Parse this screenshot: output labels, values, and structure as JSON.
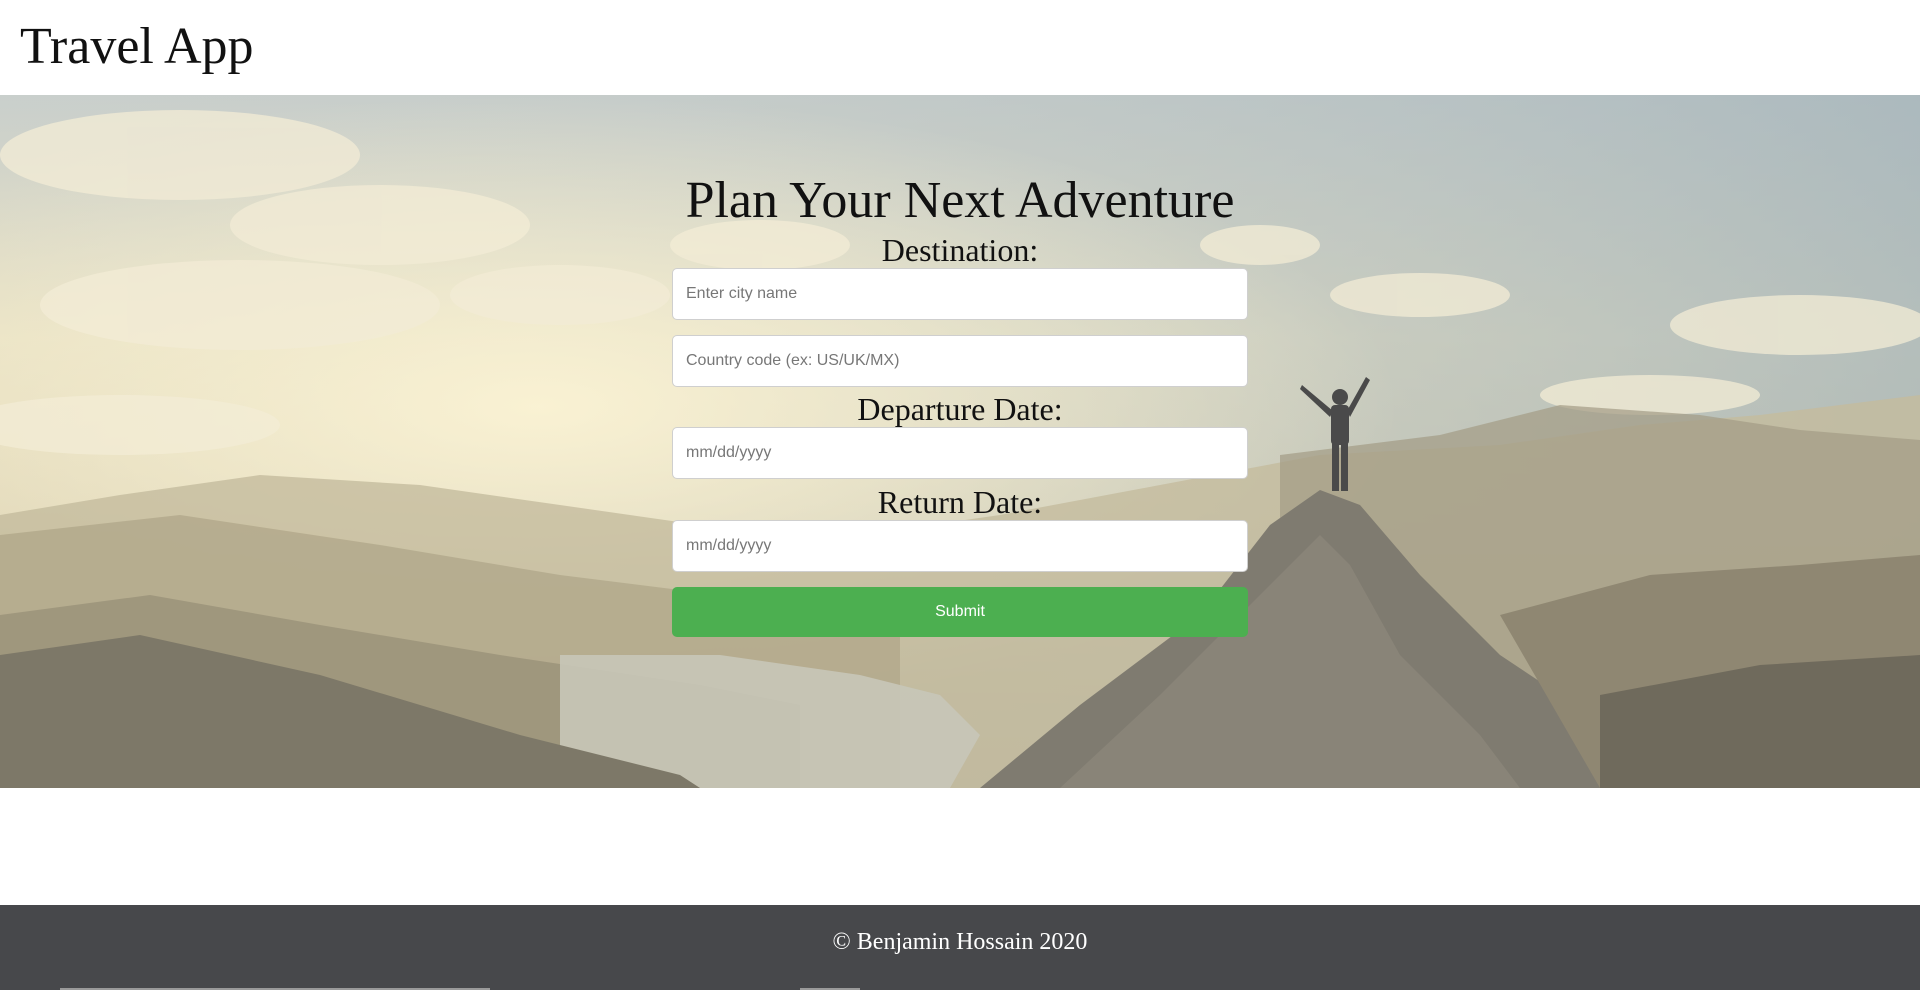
{
  "header": {
    "title": "Travel App"
  },
  "hero": {
    "background_image": "mountain-summit-photo"
  },
  "form": {
    "heading": "Plan Your Next Adventure",
    "destination_label": "Destination:",
    "city_placeholder": "Enter city name",
    "city_value": "",
    "country_placeholder": "Country code (ex: US/UK/MX)",
    "country_value": "",
    "departure_label": "Departure Date:",
    "departure_placeholder": "mm/dd/yyyy",
    "departure_value": "",
    "return_label": "Return Date:",
    "return_placeholder": "mm/dd/yyyy",
    "return_value": "",
    "submit_label": "Submit"
  },
  "footer": {
    "copyright": "© Benjamin Hossain 2020"
  },
  "colors": {
    "submit_button": "#4caf50",
    "footer_background": "#47484b",
    "page_background": "#ffffff"
  }
}
